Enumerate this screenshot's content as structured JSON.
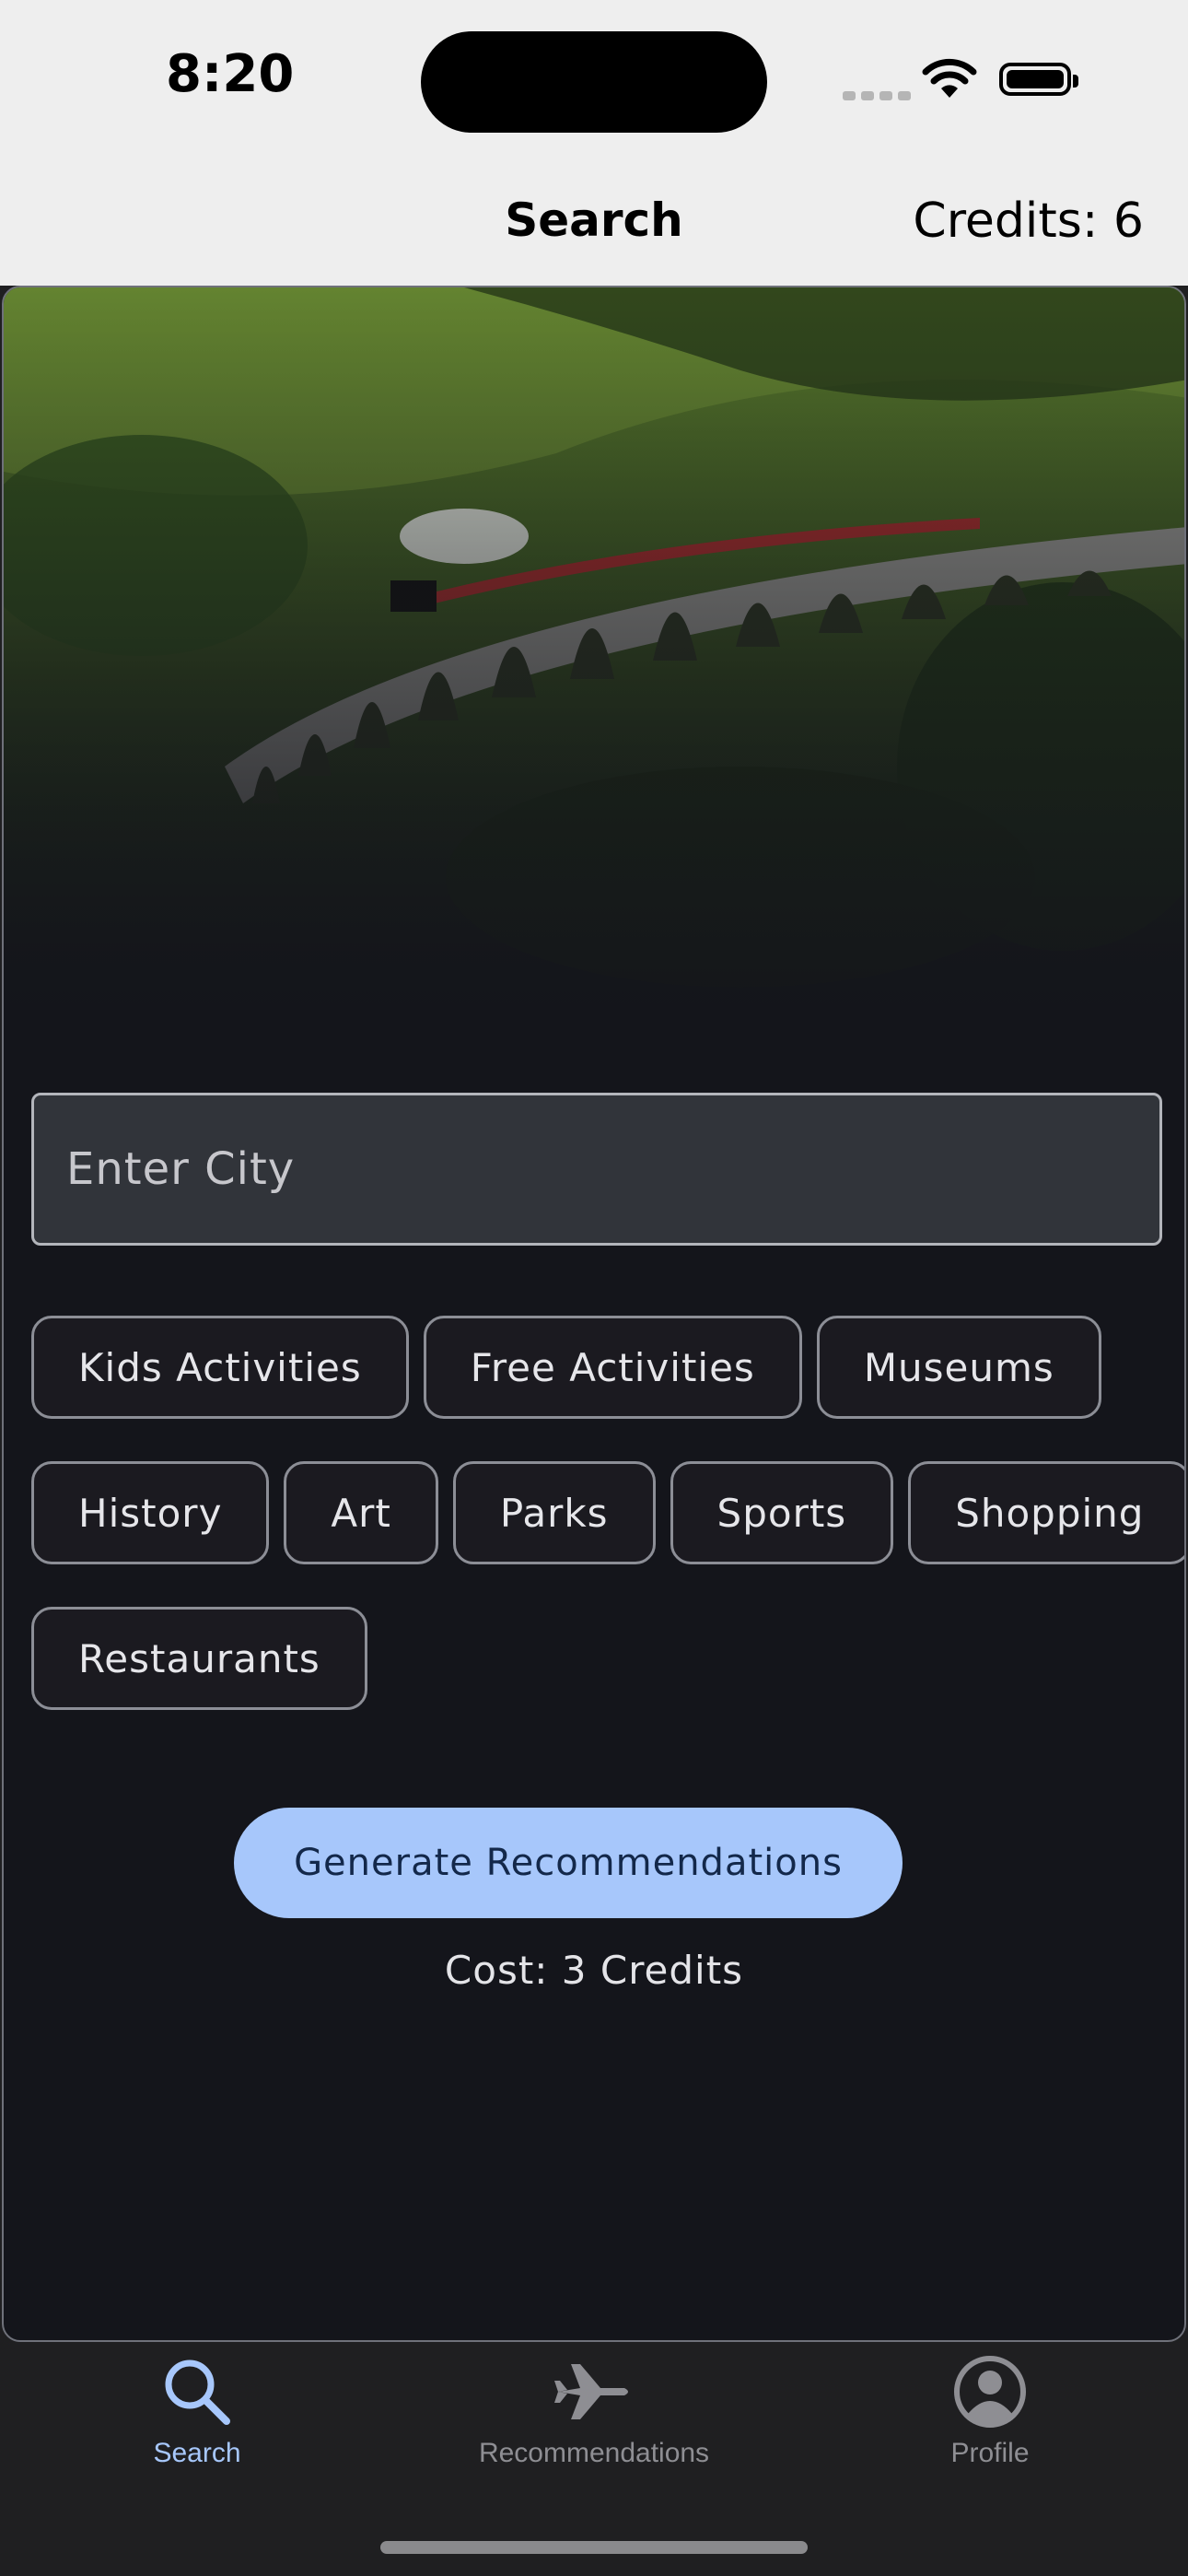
{
  "status_bar": {
    "time": "8:20"
  },
  "nav": {
    "title": "Search",
    "credits": "Credits: 6"
  },
  "hero": {
    "image": "railway-viaduct-landscape"
  },
  "search": {
    "placeholder": "Enter City",
    "value": ""
  },
  "chips": [
    [
      "Kids Activities",
      "Free Activities",
      "Museums"
    ],
    [
      "History",
      "Art",
      "Parks",
      "Sports",
      "Shopping"
    ],
    [
      "Restaurants"
    ]
  ],
  "generate": {
    "label": "Generate Recommendations",
    "cost": "Cost: 3 Credits"
  },
  "tabs": {
    "search": {
      "label": "Search",
      "icon": "search-icon",
      "active": true
    },
    "recommendations": {
      "label": "Recommendations",
      "icon": "airplane-icon"
    },
    "profile": {
      "label": "Profile",
      "icon": "profile-icon"
    }
  },
  "colors": {
    "accent": "#a7c7fb",
    "tab_active": "#a7c7fb",
    "tab_inactive": "#8e8e93",
    "background": "#14151b"
  }
}
